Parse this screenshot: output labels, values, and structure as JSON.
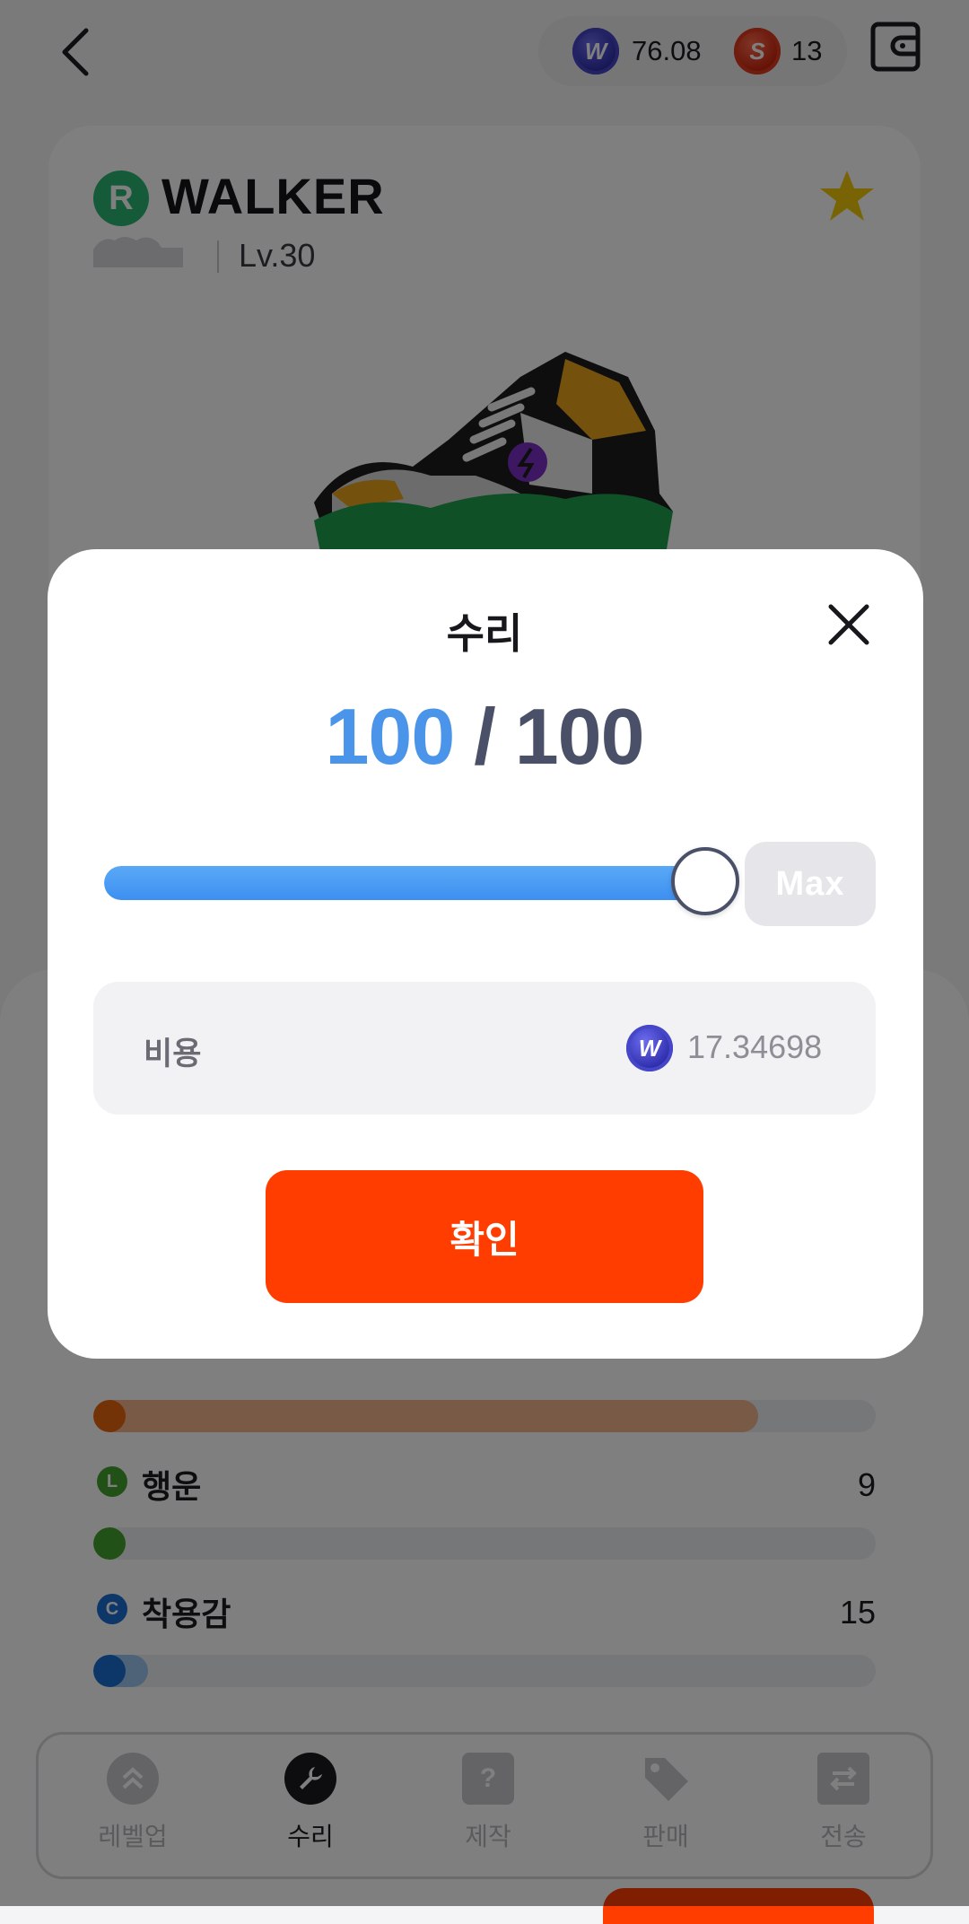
{
  "header": {
    "wallet_balances": [
      {
        "currency": "W",
        "value": "76.08"
      },
      {
        "currency": "S",
        "value": "13"
      }
    ]
  },
  "sneaker": {
    "rank": "R",
    "name": "WALKER",
    "level": "Lv.30",
    "favorite": true
  },
  "stats": [
    {
      "icon_letter": "L",
      "label": "행운",
      "value": "9",
      "color": "#45a32e",
      "fill_fraction": 0.0
    },
    {
      "icon_letter": "C",
      "label": "착용감",
      "value": "15",
      "color": "#1a6fd1",
      "fill_fraction": 0.07
    }
  ],
  "partial_stat": {
    "color": "#e8650f",
    "fill_fraction": 0.85
  },
  "tabbar": {
    "tabs": [
      {
        "label": "레벨업",
        "icon": "level-up-icon",
        "active": false
      },
      {
        "label": "수리",
        "icon": "wrench-icon",
        "active": true
      },
      {
        "label": "제작",
        "icon": "mystery-box-icon",
        "active": false
      },
      {
        "label": "판매",
        "icon": "price-tag-icon",
        "active": false
      },
      {
        "label": "전송",
        "icon": "transfer-icon",
        "active": false
      }
    ]
  },
  "repair_modal": {
    "title": "수리",
    "current": "100",
    "separator": "/",
    "max": "100",
    "slider_fraction": 1.0,
    "max_button_label": "Max",
    "cost_label": "비용",
    "cost_value": "17.34698",
    "confirm_label": "확인"
  },
  "colors": {
    "accent_blue": "#4a94ea",
    "confirm_orange": "#ff3d00",
    "rank_green": "#2bb673"
  }
}
